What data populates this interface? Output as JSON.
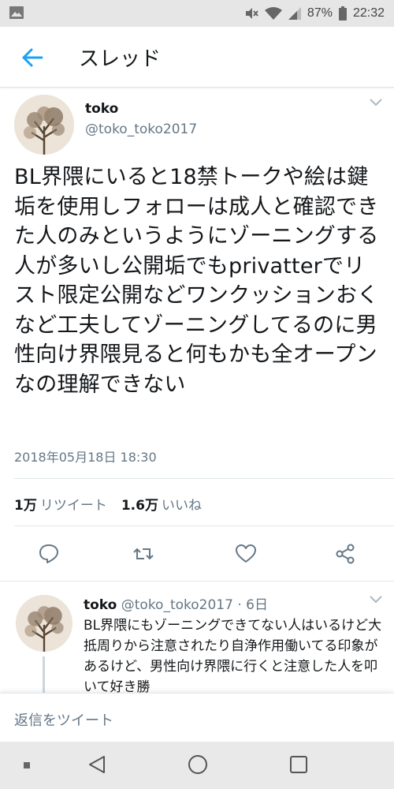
{
  "status_bar": {
    "battery": "87%",
    "time": "22:32"
  },
  "header": {
    "title": "スレッド"
  },
  "main_tweet": {
    "author_name": "toko",
    "author_handle": "@toko_toko2017",
    "text": "BL界隈にいると18禁トークや絵は鍵垢を使用しフォローは成人と確認できた人のみというようにゾーニングする人が多いし公開垢でもprivatterでリスト限定公開などワンクッションおくなど工夫してゾーニングしてるのに男性向け界隈見ると何もかも全オープンなの理解できない",
    "timestamp": "2018年05月18日 18:30",
    "retweet_count": "1万",
    "retweet_label": "リツイート",
    "like_count": "1.6万",
    "like_label": "いいね"
  },
  "reply_tweet": {
    "author_name": "toko",
    "meta": "@toko_toko2017 · 6日",
    "text": "BL界隈にもゾーニングできてない人はいるけど大抵周りから注意されたり自浄作用働いてる印象があるけど、男性向け界隈に行くと注意した人を叩いて好き勝"
  },
  "composer": {
    "placeholder": "返信をツイート"
  },
  "colors": {
    "accent": "#1da1f2",
    "secondary_text": "#657786",
    "icon_gray": "#657786"
  }
}
